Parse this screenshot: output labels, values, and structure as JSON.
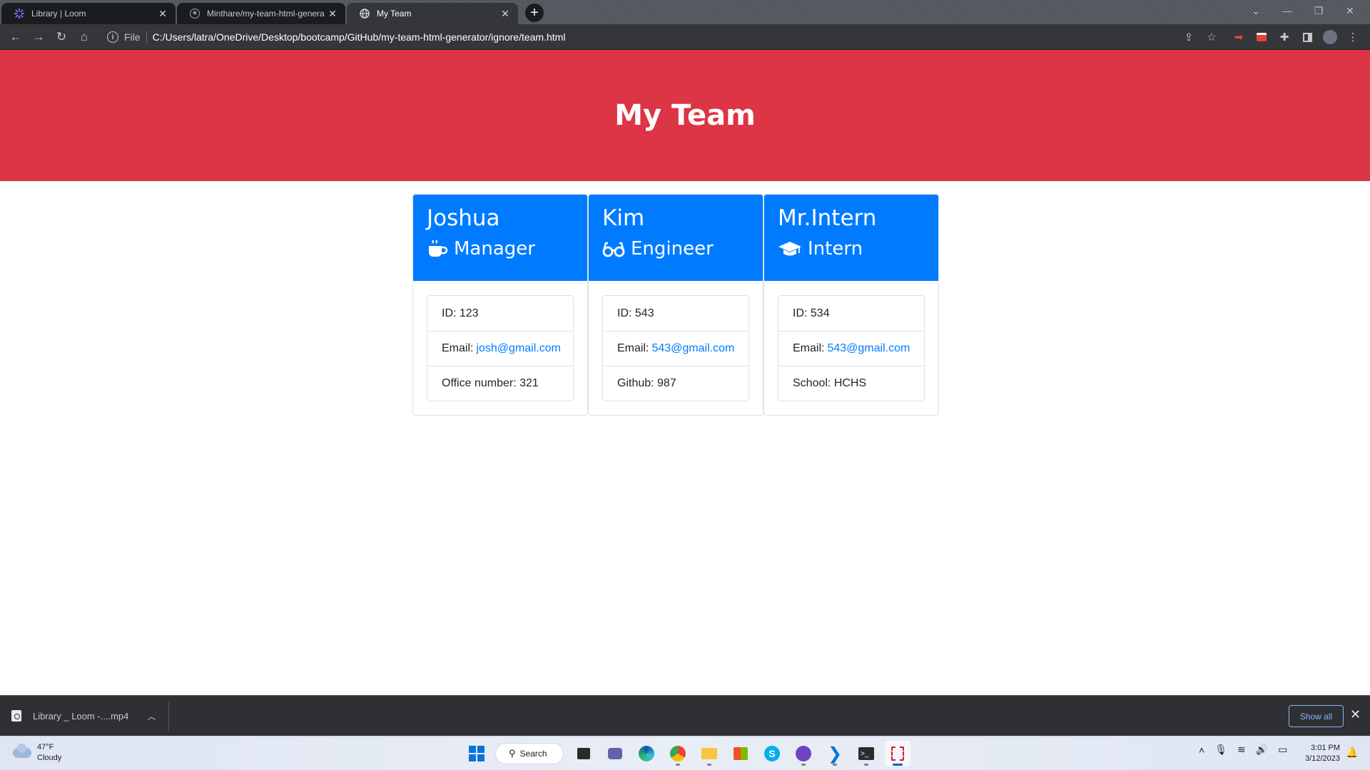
{
  "browser": {
    "tabs": [
      {
        "title": "Library | Loom",
        "favicon": "loom-icon",
        "state": "inactive"
      },
      {
        "title": "Minthare/my-team-html-genera",
        "favicon": "github-icon",
        "state": "inactive"
      },
      {
        "title": "My Team",
        "favicon": "globe-icon",
        "state": "active"
      }
    ],
    "omnibox": {
      "scheme": "File",
      "url": "C:/Users/latra/OneDrive/Desktop/bootcamp/GitHub/my-team-html-generator/ignore/team.html"
    }
  },
  "page": {
    "header": "My Team",
    "colors": {
      "header_bg": "#dc3545",
      "card_head_bg": "#007bff",
      "link": "#007bff"
    },
    "employees": [
      {
        "name": "Joshua",
        "role": "Manager",
        "role_icon": "coffee-mug-icon",
        "id_text": "ID: 123",
        "email_label": "Email:",
        "email": "josh@gmail.com",
        "extra": "Office number: 321"
      },
      {
        "name": "Kim",
        "role": "Engineer",
        "role_icon": "glasses-icon",
        "id_text": "ID: 543",
        "email_label": "Email:",
        "email": "543@gmail.com",
        "extra": "Github: 987"
      },
      {
        "name": "Mr.Intern",
        "role": "Intern",
        "role_icon": "graduation-cap-icon",
        "id_text": "ID: 534",
        "email_label": "Email:",
        "email": "543@gmail.com",
        "extra": "School: HCHS"
      }
    ]
  },
  "downloads": {
    "file": "Library _ Loom -....mp4",
    "show_all": "Show all"
  },
  "taskbar": {
    "weather": {
      "temp": "47°F",
      "condition": "Cloudy"
    },
    "search": "Search",
    "clock": {
      "time": "3:01 PM",
      "date": "3/12/2023"
    }
  }
}
